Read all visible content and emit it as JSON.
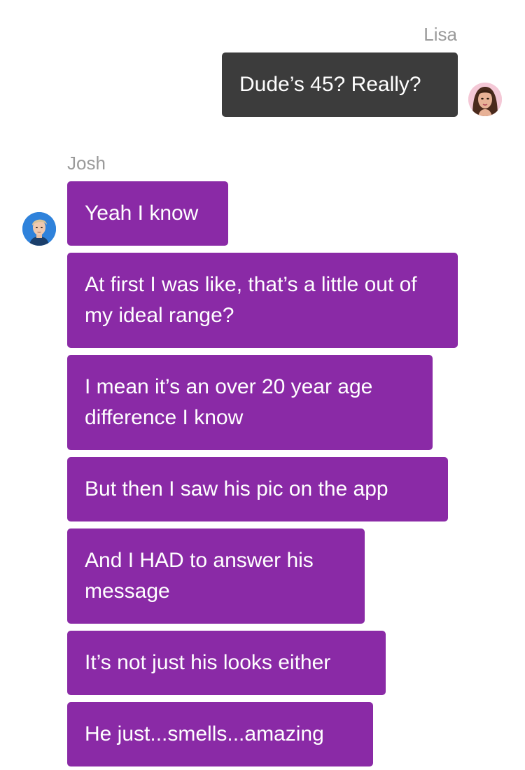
{
  "conversation": {
    "outgoing": {
      "sender": "Lisa",
      "avatar_icon": "woman-avatar-icon",
      "messages": [
        "Dude’s 45? Really?"
      ]
    },
    "incoming": {
      "sender": "Josh",
      "avatar_icon": "man-avatar-icon",
      "messages": [
        "Yeah I know",
        "At first I was like, that’s a little out of my ideal range?",
        "I mean it’s an over 20 year age difference I know",
        "But then I saw his pic on the app",
        "And I HAD to answer his message",
        "It’s not just his looks either",
        "He just...smells...amazing"
      ]
    }
  },
  "colors": {
    "outgoing_bubble": "#3c3c3c",
    "incoming_bubble": "#8a2aa6",
    "sender_name": "#9a9a9a",
    "background": "#ffffff"
  }
}
